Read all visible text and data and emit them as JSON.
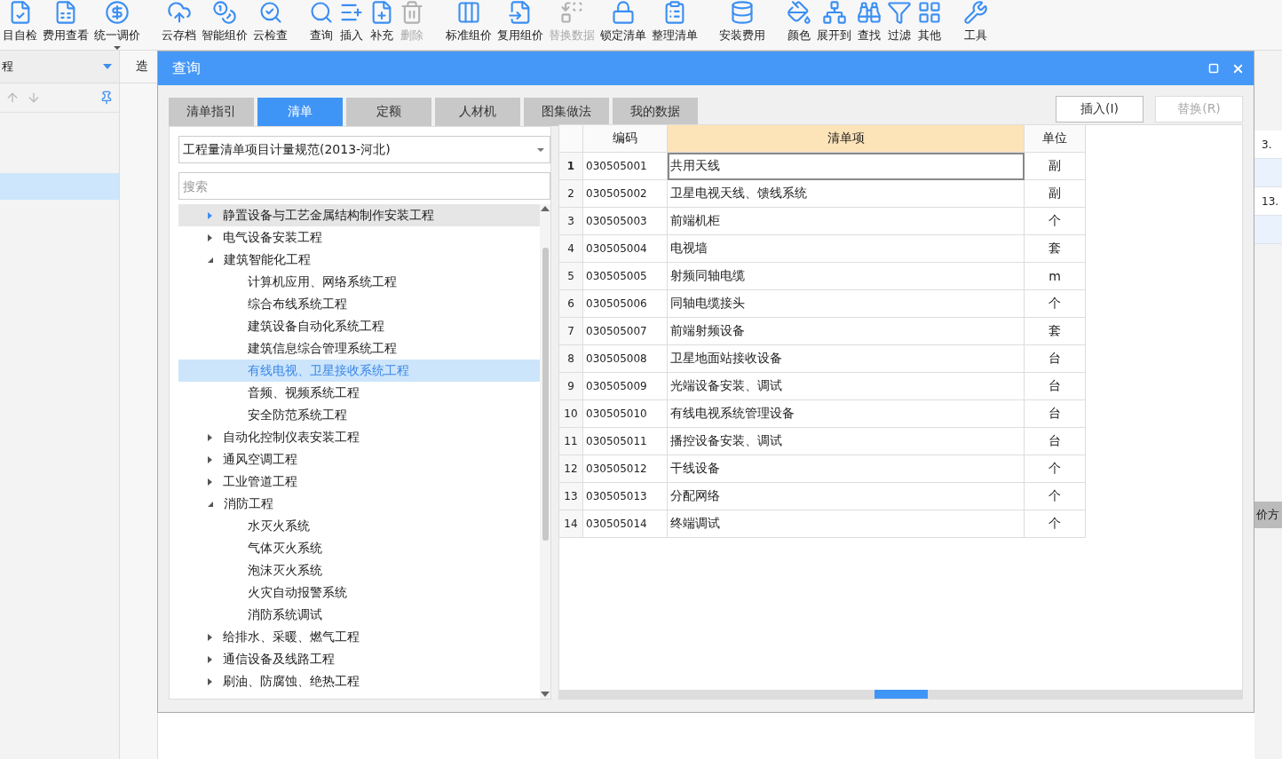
{
  "toolbar": {
    "groups": [
      [
        {
          "label": "目自检",
          "disabled": false
        },
        {
          "label": "费用查看",
          "disabled": false
        },
        {
          "label": "统一调价",
          "disabled": false,
          "dropdown": true
        }
      ],
      [
        {
          "label": "云存档",
          "disabled": false
        },
        {
          "label": "智能组价",
          "disabled": false
        },
        {
          "label": "云检查",
          "disabled": false
        }
      ],
      [
        {
          "label": "查询",
          "disabled": false
        },
        {
          "label": "插入",
          "disabled": false
        },
        {
          "label": "补充",
          "disabled": false
        },
        {
          "label": "删除",
          "disabled": true
        }
      ],
      [
        {
          "label": "标准组价",
          "disabled": false
        },
        {
          "label": "复用组价",
          "disabled": false
        },
        {
          "label": "替换数据",
          "disabled": true
        },
        {
          "label": "锁定清单",
          "disabled": false
        },
        {
          "label": "整理清单",
          "disabled": false
        }
      ],
      [
        {
          "label": "安装费用",
          "disabled": false
        }
      ],
      [
        {
          "label": "颜色",
          "disabled": false
        },
        {
          "label": "展开到",
          "disabled": false
        },
        {
          "label": "查找",
          "disabled": false
        },
        {
          "label": "过滤",
          "disabled": false
        },
        {
          "label": "其他",
          "disabled": false
        }
      ],
      [
        {
          "label": "工具",
          "disabled": false
        }
      ]
    ]
  },
  "background": {
    "left_header": "程",
    "column_header": "造",
    "cells": [
      "3.",
      "13."
    ],
    "tab": "价方"
  },
  "dialog": {
    "title": "查询",
    "tabs": [
      {
        "label": "清单指引",
        "selected": false
      },
      {
        "label": "清单",
        "selected": true
      },
      {
        "label": "定额",
        "selected": false
      },
      {
        "label": "人材机",
        "selected": false
      },
      {
        "label": "图集做法",
        "selected": false
      },
      {
        "label": "我的数据",
        "selected": false
      }
    ],
    "buttons": [
      {
        "label": "插入(I)",
        "disabled": false
      },
      {
        "label": "替换(R)",
        "disabled": true
      }
    ],
    "standard": "工程量清单项目计量规范(2013-河北)",
    "search": {
      "placeholder": "搜索"
    },
    "tree": [
      {
        "label": "静置设备与工艺金属结构制作安装工程",
        "expanded": false,
        "hovered": true,
        "selected": false
      },
      {
        "label": "电气设备安装工程",
        "expanded": false,
        "hovered": false,
        "selected": false
      },
      {
        "label": "建筑智能化工程",
        "expanded": true,
        "hovered": false,
        "selected": false,
        "children": [
          {
            "label": "计算机应用、网络系统工程",
            "selected": false
          },
          {
            "label": "综合布线系统工程",
            "selected": false
          },
          {
            "label": "建筑设备自动化系统工程",
            "selected": false
          },
          {
            "label": "建筑信息综合管理系统工程",
            "selected": false
          },
          {
            "label": "有线电视、卫星接收系统工程",
            "selected": true
          },
          {
            "label": "音频、视频系统工程",
            "selected": false
          },
          {
            "label": "安全防范系统工程",
            "selected": false
          }
        ]
      },
      {
        "label": "自动化控制仪表安装工程",
        "expanded": false,
        "hovered": false,
        "selected": false
      },
      {
        "label": "通风空调工程",
        "expanded": false,
        "hovered": false,
        "selected": false
      },
      {
        "label": "工业管道工程",
        "expanded": false,
        "hovered": false,
        "selected": false
      },
      {
        "label": "消防工程",
        "expanded": true,
        "hovered": false,
        "selected": false,
        "children": [
          {
            "label": "水灭火系统",
            "selected": false
          },
          {
            "label": "气体灭火系统",
            "selected": false
          },
          {
            "label": "泡沫灭火系统",
            "selected": false
          },
          {
            "label": "火灾自动报警系统",
            "selected": false
          },
          {
            "label": "消防系统调试",
            "selected": false
          }
        ]
      },
      {
        "label": "给排水、采暖、燃气工程",
        "expanded": false,
        "hovered": false,
        "selected": false
      },
      {
        "label": "通信设备及线路工程",
        "expanded": false,
        "hovered": false,
        "selected": false
      },
      {
        "label": "刷油、防腐蚀、绝热工程",
        "expanded": false,
        "hovered": false,
        "selected": false
      }
    ],
    "table": {
      "columns": [
        "编码",
        "清单项",
        "单位"
      ],
      "rows": [
        {
          "no": "1",
          "code": "030505001",
          "name": "共用天线",
          "unit": "副",
          "selected": true
        },
        {
          "no": "2",
          "code": "030505002",
          "name": "卫星电视天线、馈线系统",
          "unit": "副",
          "selected": false
        },
        {
          "no": "3",
          "code": "030505003",
          "name": "前端机柜",
          "unit": "个",
          "selected": false
        },
        {
          "no": "4",
          "code": "030505004",
          "name": "电视墙",
          "unit": "套",
          "selected": false
        },
        {
          "no": "5",
          "code": "030505005",
          "name": "射频同轴电缆",
          "unit": "m",
          "selected": false
        },
        {
          "no": "6",
          "code": "030505006",
          "name": "同轴电缆接头",
          "unit": "个",
          "selected": false
        },
        {
          "no": "7",
          "code": "030505007",
          "name": "前端射频设备",
          "unit": "套",
          "selected": false
        },
        {
          "no": "8",
          "code": "030505008",
          "name": "卫星地面站接收设备",
          "unit": "台",
          "selected": false
        },
        {
          "no": "9",
          "code": "030505009",
          "name": "光端设备安装、调试",
          "unit": "台",
          "selected": false
        },
        {
          "no": "10",
          "code": "030505010",
          "name": "有线电视系统管理设备",
          "unit": "台",
          "selected": false
        },
        {
          "no": "11",
          "code": "030505011",
          "name": "播控设备安装、调试",
          "unit": "台",
          "selected": false
        },
        {
          "no": "12",
          "code": "030505012",
          "name": "干线设备",
          "unit": "个",
          "selected": false
        },
        {
          "no": "13",
          "code": "030505013",
          "name": "分配网络",
          "unit": "个",
          "selected": false
        },
        {
          "no": "14",
          "code": "030505014",
          "name": "终端调试",
          "unit": "个",
          "selected": false
        }
      ]
    }
  }
}
